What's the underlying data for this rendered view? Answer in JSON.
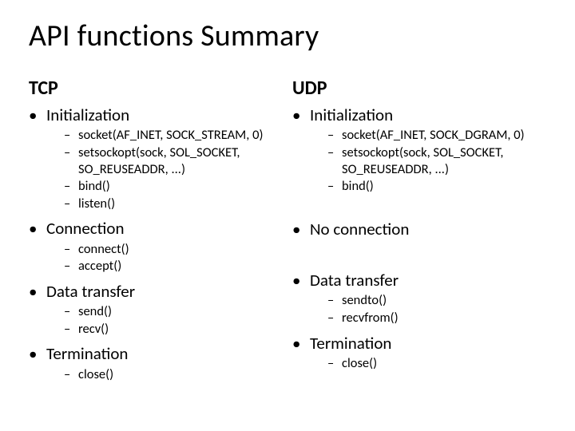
{
  "title": "API functions Summary",
  "columns": [
    {
      "heading": "TCP",
      "items": [
        {
          "label": "Initialization",
          "sub": [
            "socket(AF_INET, SOCK_STREAM, 0)",
            "setsockopt(sock, SOL_SOCKET, SO_REUSEADDR, ...)",
            "bind()",
            "listen()"
          ]
        },
        {
          "label": "Connection",
          "sub": [
            "connect()",
            "accept()"
          ]
        },
        {
          "label": "Data transfer",
          "sub": [
            "send()",
            "recv()"
          ]
        },
        {
          "label": "Termination",
          "sub": [
            "close()"
          ]
        }
      ]
    },
    {
      "heading": "UDP",
      "items": [
        {
          "label": "Initialization",
          "sub": [
            "socket(AF_INET, SOCK_DGRAM, 0)",
            "setsockopt(sock, SOL_SOCKET, SO_REUSEADDR, ...)",
            "bind()"
          ]
        },
        {
          "label": "No connection",
          "sub": []
        },
        {
          "label": "Data transfer",
          "sub": [
            "sendto()",
            "recvfrom()"
          ]
        },
        {
          "label": "Termination",
          "sub": [
            "close()"
          ]
        }
      ]
    }
  ]
}
